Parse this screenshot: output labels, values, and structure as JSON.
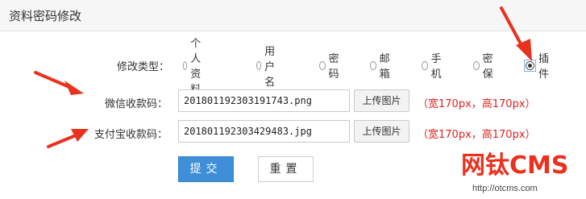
{
  "header": {
    "title": "资料密码修改"
  },
  "form": {
    "type_label": "修改类型：",
    "options": [
      {
        "label": "个人资料",
        "checked": false
      },
      {
        "label": "用户名",
        "checked": false
      },
      {
        "label": "密码",
        "checked": false
      },
      {
        "label": "邮箱",
        "checked": false
      },
      {
        "label": "手机",
        "checked": false
      },
      {
        "label": "密保",
        "checked": false
      },
      {
        "label": "插件",
        "checked": true
      }
    ],
    "wechat": {
      "label": "微信收款码：",
      "value": "201801192303191743.png",
      "upload_label": "上传图片",
      "hint": "（宽170px，高170px）"
    },
    "alipay": {
      "label": "支付宝收款码：",
      "value": "201801192303429483.jpg",
      "upload_label": "上传图片",
      "hint": "（宽170px，高170px）"
    },
    "submit_label": "提交",
    "reset_label": "重置"
  },
  "watermark": {
    "logo_text": "网钛CMS",
    "url": "http://otcms.com"
  },
  "colors": {
    "accent": "#3e8fd8",
    "hint": "#e02020",
    "arrow": "#e8321e"
  }
}
